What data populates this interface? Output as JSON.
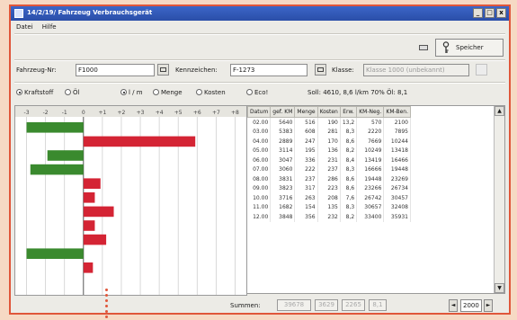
{
  "window": {
    "title": "14/2/19/ Fahrzeug Verbrauchsgerät",
    "minimize": "_",
    "maximize": "□",
    "close": "x"
  },
  "menu": [
    "Datei",
    "Hilfe"
  ],
  "toolbar": {
    "save_label": "Speicher"
  },
  "fields": {
    "fahrzeug_label": "Fahrzeug-Nr:",
    "fahrzeug_value": "F1000",
    "kennzeichen_label": "Kennzeichen:",
    "kennzeichen_value": "F-1273",
    "klasse_label": "Klasse:",
    "klasse_value": "Klasse 1000 (unbekannt)"
  },
  "options": {
    "group1": [
      {
        "label": "Kraftstoff",
        "selected": true
      },
      {
        "label": "Öl",
        "selected": false
      }
    ],
    "group2": [
      {
        "label": "l / m",
        "selected": true
      },
      {
        "label": "Menge",
        "selected": false
      },
      {
        "label": "Kosten",
        "selected": false
      },
      {
        "label": "Eco!",
        "selected": false
      }
    ],
    "summary": "Soll: 4610, 8,6 l/km  70% Öl: 8,1"
  },
  "chart_data": {
    "type": "bar",
    "orientation": "horizontal",
    "ticks": [
      "-3",
      "-2",
      "-1",
      "0",
      "+1",
      "+2",
      "+3",
      "+4",
      "+5",
      "+6",
      "+7",
      "+8"
    ],
    "zero_tick": "0",
    "categories": [
      "02.00",
      "03.00",
      "04.00",
      "05.00",
      "06.00",
      "07.00",
      "08.00",
      "09.00",
      "10.00",
      "11.00",
      "12.00"
    ],
    "values": [
      -3.0,
      5.9,
      -1.9,
      -2.8,
      0.9,
      0.6,
      1.6,
      0.6,
      1.2,
      -3.0,
      0.5
    ],
    "colors": {
      "positive": "#d42434",
      "negative": "#3a8a2e"
    }
  },
  "table": {
    "columns": [
      "Datum",
      "gef. KM",
      "Menge",
      "Kosten",
      "Erw.",
      "KM-Neg.",
      "KM-Ben."
    ],
    "rows": [
      [
        "02.00",
        "5640",
        "516",
        "190",
        "13,2",
        "570",
        "2100"
      ],
      [
        "03.00",
        "5383",
        "608",
        "281",
        "8,3",
        "2220",
        "7895"
      ],
      [
        "04.00",
        "2889",
        "247",
        "170",
        "8,6",
        "7669",
        "10244"
      ],
      [
        "05.00",
        "3114",
        "195",
        "136",
        "8,2",
        "10249",
        "13418"
      ],
      [
        "06.00",
        "3047",
        "336",
        "231",
        "8,4",
        "13419",
        "16466"
      ],
      [
        "07.00",
        "3060",
        "222",
        "237",
        "8,3",
        "16666",
        "19448"
      ],
      [
        "08.00",
        "3831",
        "237",
        "286",
        "8,6",
        "19448",
        "23269"
      ],
      [
        "09.00",
        "3823",
        "317",
        "223",
        "8,6",
        "23266",
        "26734"
      ],
      [
        "10.00",
        "3716",
        "263",
        "208",
        "7,6",
        "26742",
        "30457"
      ],
      [
        "11.00",
        "1682",
        "154",
        "135",
        "8,3",
        "30657",
        "32408"
      ],
      [
        "12.00",
        "3848",
        "356",
        "232",
        "8,2",
        "33400",
        "35931"
      ]
    ]
  },
  "footer": {
    "summen_label": "Summen:",
    "sums": [
      "39678",
      "3629",
      "2265",
      "8,1"
    ],
    "year": "2000",
    "year_prev": "◄",
    "year_next": "►"
  }
}
